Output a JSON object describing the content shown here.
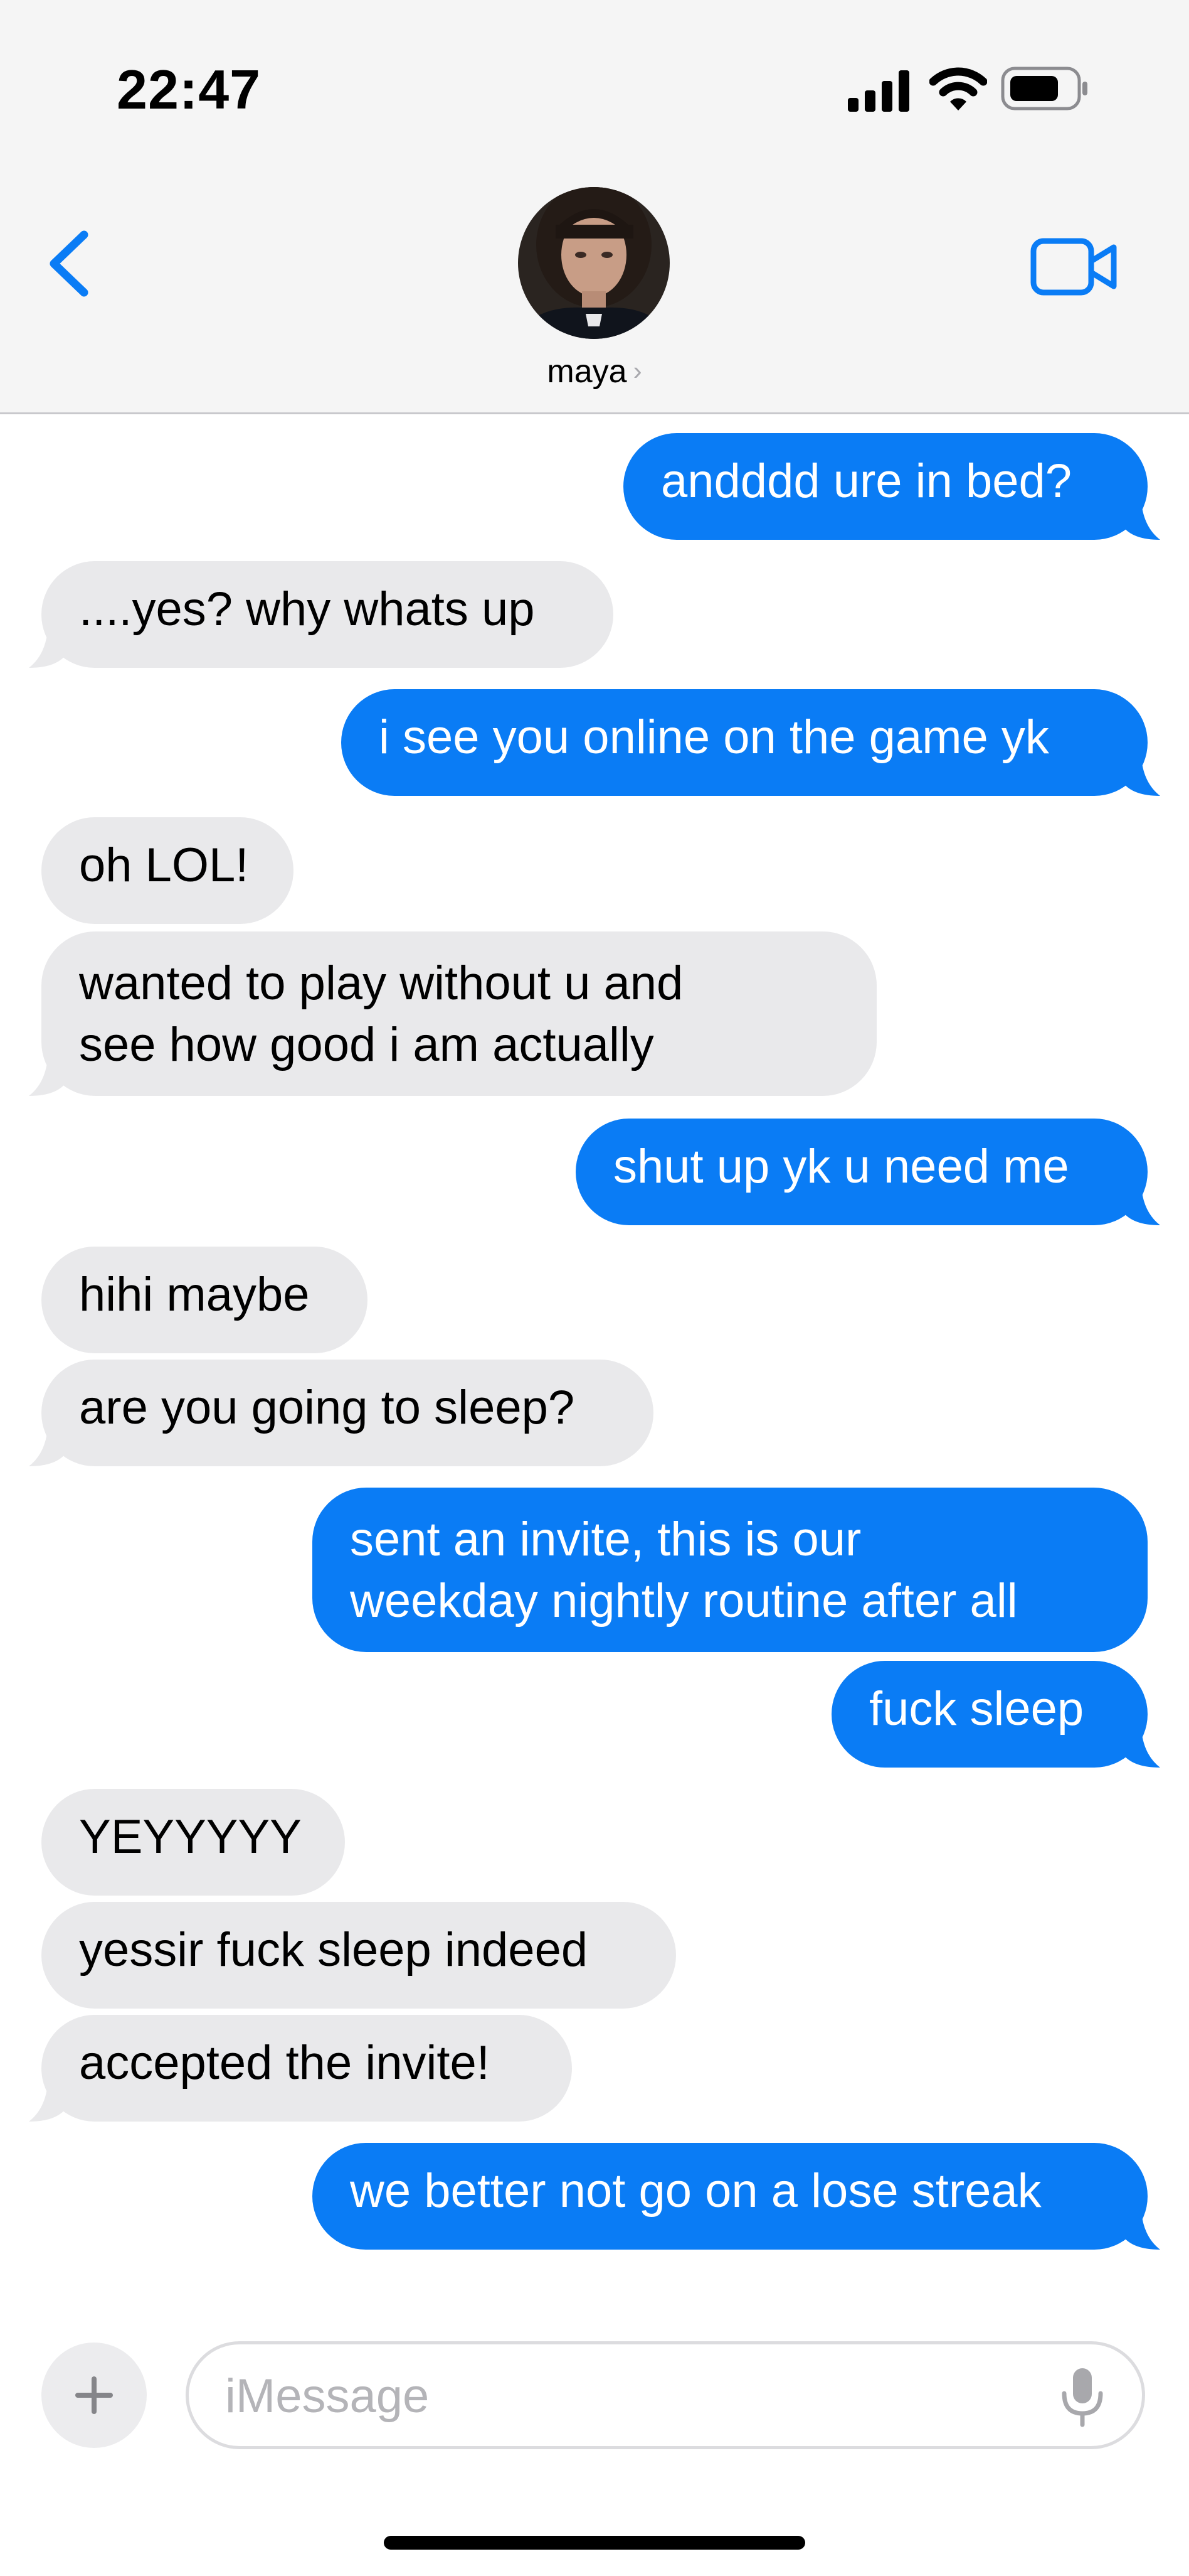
{
  "status_bar": {
    "time": "22:47"
  },
  "header": {
    "contact_name": "maya",
    "chevron": "›",
    "back_icon": "chevron-left-icon",
    "video_icon": "video-camera-icon"
  },
  "messages": [
    {
      "direction": "out",
      "text": "andddd ure in bed?"
    },
    {
      "direction": "in",
      "text": "....yes? why whats up"
    },
    {
      "direction": "out",
      "text": "i see you online on the game yk"
    },
    {
      "direction": "in",
      "text": "oh LOL!"
    },
    {
      "direction": "in",
      "lines": [
        "wanted to play without u and",
        "see how good i am actually"
      ]
    },
    {
      "direction": "out",
      "text": "shut up yk u need me"
    },
    {
      "direction": "in",
      "text": "hihi maybe"
    },
    {
      "direction": "in",
      "text": "are you going to sleep?"
    },
    {
      "direction": "out",
      "lines": [
        "sent an invite, this is our",
        "weekday nightly routine after all"
      ]
    },
    {
      "direction": "out",
      "text": "fuck sleep"
    },
    {
      "direction": "in",
      "text": "YEYYYYY"
    },
    {
      "direction": "in",
      "text": "yessir fuck sleep indeed"
    },
    {
      "direction": "in",
      "text": "accepted the invite!"
    },
    {
      "direction": "out",
      "text": "we better not go on a lose streak"
    }
  ],
  "composer": {
    "placeholder": "iMessage",
    "value": "",
    "add_icon": "plus-icon",
    "mic_icon": "microphone-icon"
  },
  "colors": {
    "outgoing_bubble": "#0a7cf5",
    "incoming_bubble": "#e9e9eb",
    "accent": "#0a7cf5"
  }
}
